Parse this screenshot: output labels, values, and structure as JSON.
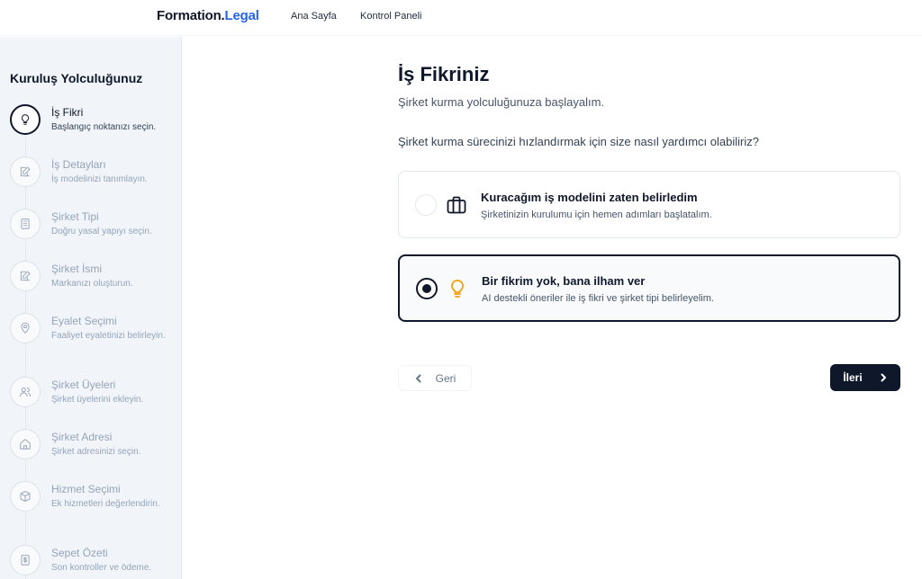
{
  "header": {
    "brand_main": "Formation.",
    "brand_accent": "Legal",
    "nav": [
      {
        "label": "Ana Sayfa"
      },
      {
        "label": "Kontrol Paneli"
      }
    ]
  },
  "sidebar": {
    "title": "Kuruluş Yolculuğunuz",
    "steps": [
      {
        "title": "İş Fikri",
        "desc": "Başlangıç noktanızı seçin.",
        "icon": "lightbulb-icon",
        "active": true
      },
      {
        "title": "İş Detayları",
        "desc": "İş modelinizi tanımlayın.",
        "icon": "edit-icon"
      },
      {
        "title": "Şirket Tipi",
        "desc": "Doğru yasal yapıyı seçin.",
        "icon": "building-icon"
      },
      {
        "title": "Şirket İsmi",
        "desc": "Markanızı oluşturun.",
        "icon": "edit-icon"
      },
      {
        "title": "Eyalet Seçimi",
        "desc": "Faaliyet eyaletinizi belirleyin.",
        "icon": "map-pin-icon"
      },
      {
        "title": "Şirket Üyeleri",
        "desc": "Şirket üyelerini ekleyin.",
        "icon": "users-icon"
      },
      {
        "title": "Şirket Adresi",
        "desc": "Şirket adresinizi seçin.",
        "icon": "home-icon"
      },
      {
        "title": "Hizmet Seçimi",
        "desc": "Ek hizmetleri değerlendirin.",
        "icon": "package-icon"
      },
      {
        "title": "Sepet Özeti",
        "desc": "Son kontroller ve ödeme.",
        "icon": "receipt-icon"
      }
    ]
  },
  "main": {
    "title": "İş Fikriniz",
    "subtitle": "Şirket kurma yolculuğunuza başlayalım.",
    "question": "Şirket kurma sürecinizi hızlandırmak için size nasıl yardımcı olabiliriz?",
    "options": [
      {
        "title": "Kuracağım iş modelini zaten belirledim",
        "desc": "Şirketinizin kurulumu için hemen adımları başlatalım.",
        "icon": "briefcase-icon",
        "selected": false
      },
      {
        "title": "Bir fikrim yok, bana ilham ver",
        "desc": "AI destekli öneriler ile iş fikri ve şirket tipi belirleyelim.",
        "icon": "lightbulb-icon",
        "selected": true
      }
    ],
    "back_label": "Geri",
    "next_label": "İleri"
  },
  "colors": {
    "brand_accent": "#2563eb",
    "primary": "#0f172a",
    "idea_icon": "#f59e0b"
  }
}
